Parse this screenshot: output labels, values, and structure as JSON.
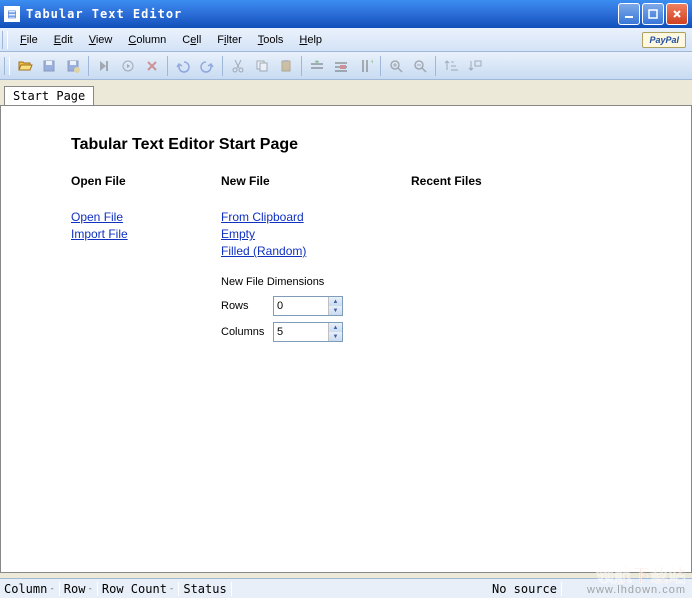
{
  "window": {
    "title": "Tabular Text Editor"
  },
  "menu": {
    "file": "File",
    "edit": "Edit",
    "view": "View",
    "column": "Column",
    "cell": "Cell",
    "filter": "Filter",
    "tools": "Tools",
    "help": "Help",
    "paypal": "PayPal"
  },
  "tabs": {
    "start": "Start Page"
  },
  "page": {
    "heading": "Tabular Text Editor Start Page",
    "open": {
      "title": "Open File",
      "open_link": "Open File",
      "import_link": "Import File"
    },
    "new": {
      "title": "New File",
      "from_clipboard": "From Clipboard",
      "empty": "Empty",
      "filled": "Filled (Random)",
      "dims_heading": "New File Dimensions",
      "rows_label": "Rows",
      "rows_value": "0",
      "cols_label": "Columns",
      "cols_value": "5"
    },
    "recent": {
      "title": "Recent Files"
    }
  },
  "status": {
    "column": "Column",
    "row": "Row",
    "row_count": "Row Count",
    "status_label": "Status",
    "dash": "-",
    "source": "No source"
  },
  "watermark": {
    "line1": "领航下载站",
    "line2": "www.lhdown.com"
  }
}
